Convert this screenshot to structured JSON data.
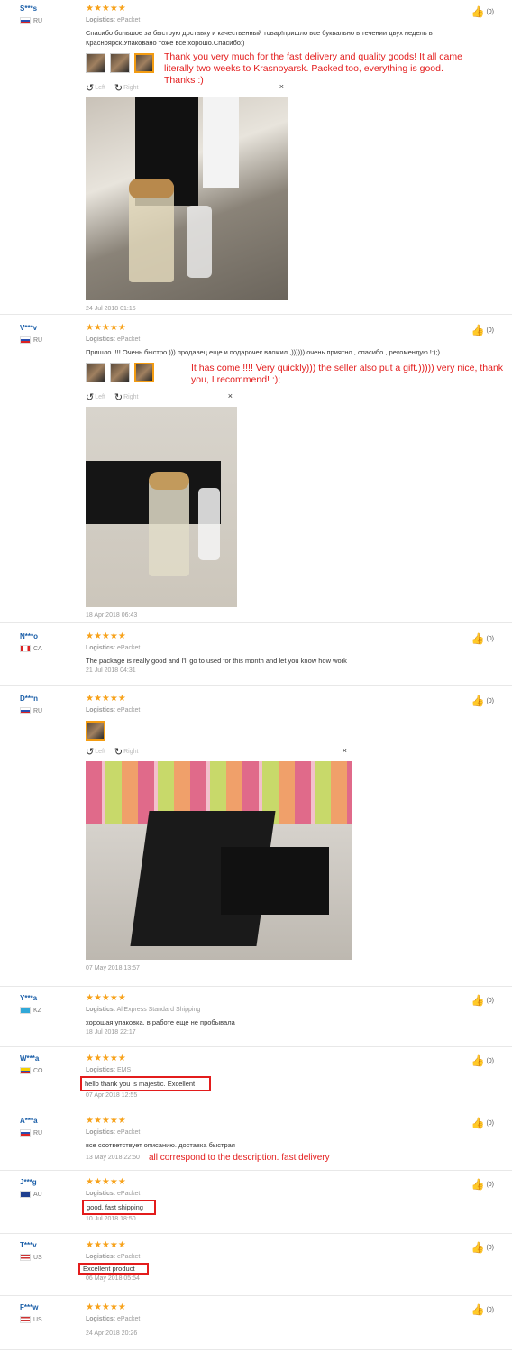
{
  "reviews": [
    {
      "user": "S***s",
      "country": "RU",
      "stars": "★★★★★",
      "logistics_label": "Logistics:",
      "logistics": "ePacket",
      "text": "Спасибо большое за быструю доставку и качественный товар!пришло все буквально в течении двух недель в Красноярск.Упаковано тоже всё хорошо.Спасибо:)",
      "translation": "Thank you very much for the fast delivery and quality goods! It all came literally two weeks to Krasnoyarsk. Packed too, everything is good. Thanks :)",
      "left": "Left",
      "right": "Right",
      "close": "×",
      "date": "24 Jul 2018 01:15",
      "helpful": "(0)"
    },
    {
      "user": "V***v",
      "country": "RU",
      "stars": "★★★★★",
      "logistics_label": "Logistics:",
      "logistics": "ePacket",
      "text": "Пришло !!!! Очень быстро ))) продавец еще и подарочек вложил ,)))))) очень приятно , спасибо , рекомендую !:);)",
      "translation": "It has come !!!! Very quickly))) the seller also put a gift.))))) very nice, thank you, I recommend! :);",
      "left": "Left",
      "right": "Right",
      "close": "×",
      "date": "18 Apr 2018 06:43",
      "helpful": "(0)"
    },
    {
      "user": "N***o",
      "country": "CA",
      "stars": "★★★★★",
      "logistics_label": "Logistics:",
      "logistics": "ePacket",
      "text": "The package is really good and I'll go to used for this month and let you know how work",
      "date": "21 Jul 2018 04:31",
      "helpful": "(0)"
    },
    {
      "user": "D***n",
      "country": "RU",
      "stars": "★★★★★",
      "logistics_label": "Logistics:",
      "logistics": "ePacket",
      "left": "Left",
      "right": "Right",
      "close": "×",
      "date": "07 May 2018 13:57",
      "helpful": "(0)"
    },
    {
      "user": "Y***a",
      "country": "KZ",
      "stars": "★★★★★",
      "logistics_label": "Logistics:",
      "logistics": "AliExpress Standard Shipping",
      "text": "хорошая упаковка. в работе еще не пробывала",
      "date": "18 Jul 2018 22:17",
      "helpful": "(0)"
    },
    {
      "user": "W***a",
      "country": "CO",
      "stars": "★★★★★",
      "logistics_label": "Logistics:",
      "logistics": "EMS",
      "text": "hello thank you is majestic. Excellent",
      "date": "07 Apr 2018 12:55",
      "helpful": "(0)"
    },
    {
      "user": "A***a",
      "country": "RU",
      "stars": "★★★★★",
      "logistics_label": "Logistics:",
      "logistics": "ePacket",
      "text": "все соответствует описанию. доставка быстрая",
      "translation": "all correspond to the description. fast delivery",
      "date": "13 May 2018 22:50",
      "helpful": "(0)"
    },
    {
      "user": "J***g",
      "country": "AU",
      "stars": "★★★★★",
      "logistics_label": "Logistics:",
      "logistics": "ePacket",
      "text": "good, fast shipping",
      "date": "10 Jul 2018 18:50",
      "helpful": "(0)"
    },
    {
      "user": "T***v",
      "country": "US",
      "stars": "★★★★★",
      "logistics_label": "Logistics:",
      "logistics": "ePacket",
      "text": "Excellent product",
      "date": "06 May 2018 05:54",
      "helpful": "(0)"
    },
    {
      "user": "F***w",
      "country": "US",
      "stars": "★★★★★",
      "logistics_label": "Logistics:",
      "logistics": "ePacket",
      "date": "24 Apr 2018 20:26",
      "helpful": "(0)"
    }
  ],
  "icons": {
    "thumb": "thumbs-up-icon",
    "rotate_left": "rotate-left-icon",
    "rotate_right": "rotate-right-icon",
    "close": "close-icon"
  },
  "colors": {
    "name": "#1a5ea8",
    "stars": "#f7a21b",
    "annotation": "#e31c1c"
  }
}
